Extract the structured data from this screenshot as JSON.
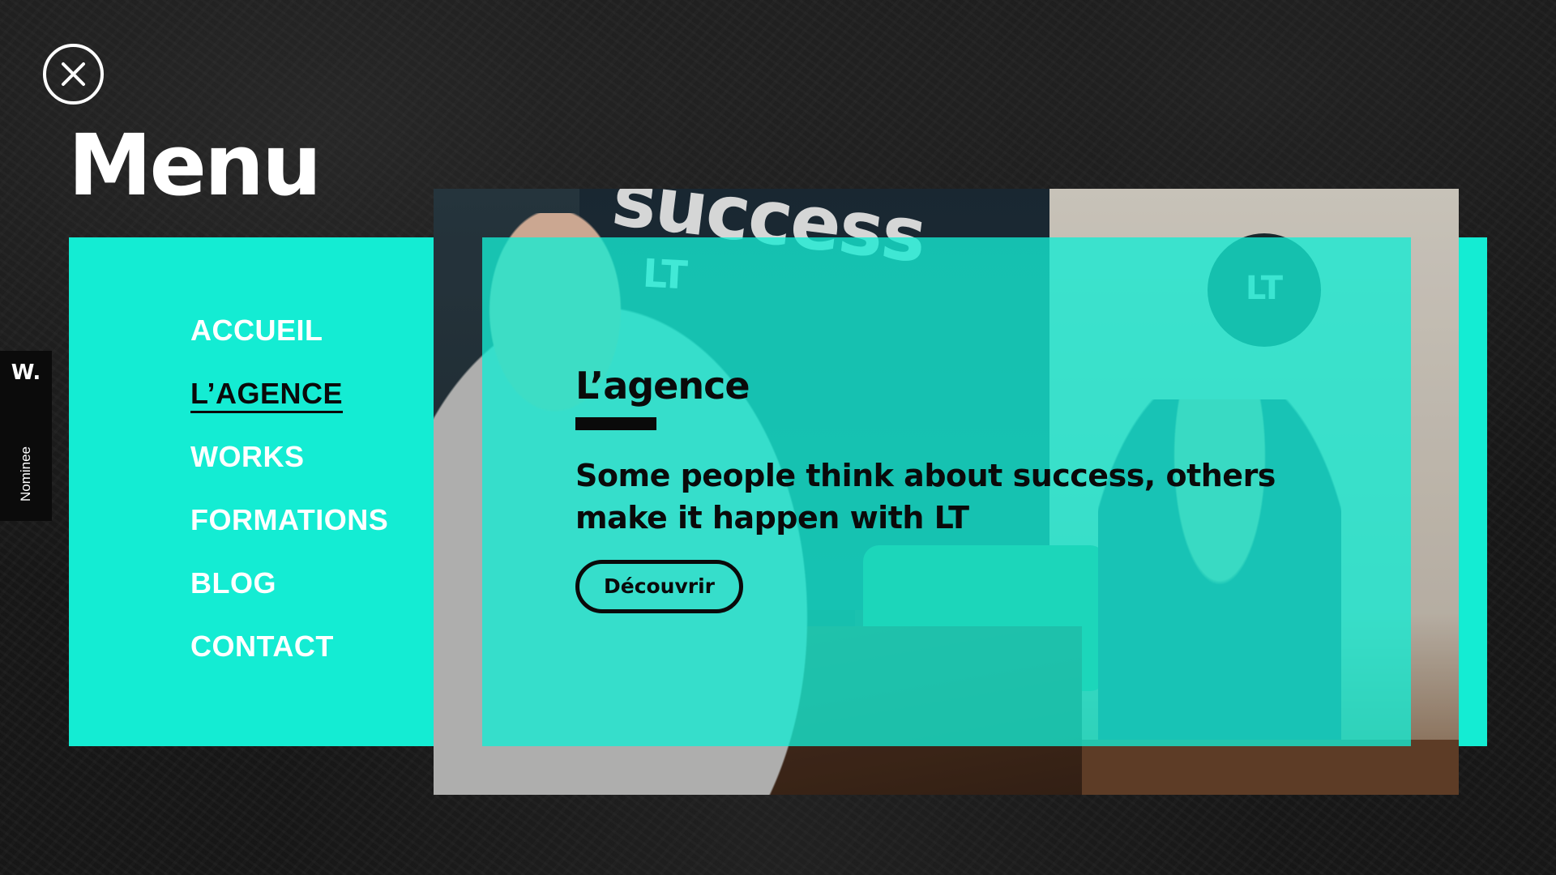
{
  "colors": {
    "accent": "#14ecd3",
    "background": "#181818",
    "text_light": "#ffffff",
    "text_dark": "#0a0a0a"
  },
  "close": {
    "icon": "close-icon"
  },
  "menu": {
    "title": "Menu",
    "items": [
      {
        "label": "ACCUEIL",
        "active": false
      },
      {
        "label": "L’AGENCE",
        "active": true
      },
      {
        "label": "WORKS",
        "active": false
      },
      {
        "label": "FORMATIONS",
        "active": false
      },
      {
        "label": "BLOG",
        "active": false
      },
      {
        "label": "CONTACT",
        "active": false
      }
    ]
  },
  "preview": {
    "photo_wall_text": "success",
    "photo_wall_subtext": "LT",
    "photo_logo_text": "LT",
    "title": "L’agence",
    "description": "Some people think about success, others make it happen with LT",
    "button_label": "Découvrir"
  },
  "badge": {
    "logo": "W.",
    "label": "Nominee"
  }
}
